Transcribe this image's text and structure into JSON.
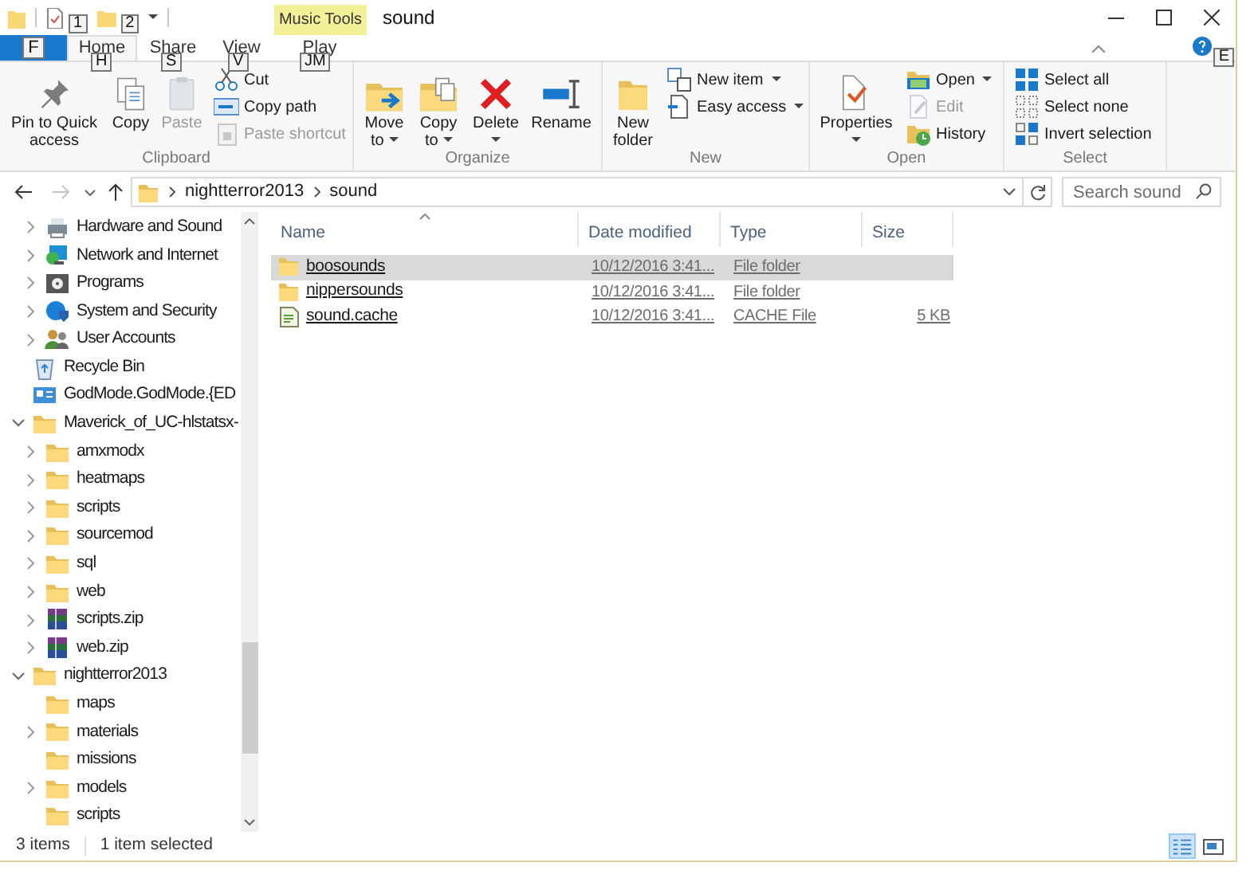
{
  "window": {
    "title": "sound",
    "contextual_group": "Music Tools"
  },
  "quick_access": {
    "keytips": [
      "1",
      "2"
    ]
  },
  "tabs": [
    {
      "kind": "file",
      "keytip": "F",
      "selected": false
    },
    {
      "kind": "tab",
      "label": "Home",
      "keytip": "H",
      "selected": true
    },
    {
      "kind": "tab",
      "label": "Share",
      "keytip": "S",
      "selected": false
    },
    {
      "kind": "tab",
      "label": "View",
      "keytip": "V",
      "selected": false
    },
    {
      "kind": "contextual",
      "label": "Play",
      "keytip": "JM",
      "selected": false
    }
  ],
  "help": {
    "keytip": "E"
  },
  "ribbon": {
    "groups": [
      {
        "label": "Clipboard",
        "items": [
          {
            "kind": "large",
            "label": "Pin to Quick access",
            "disabled": false,
            "dropdown": false
          },
          {
            "kind": "large",
            "label": "Copy",
            "disabled": false,
            "dropdown": false
          },
          {
            "kind": "large",
            "label": "Paste",
            "disabled": true,
            "dropdown": false
          },
          {
            "kind": "small",
            "label": "Cut",
            "disabled": false,
            "dropdown": false
          },
          {
            "kind": "small",
            "label": "Copy path",
            "disabled": false,
            "dropdown": false
          },
          {
            "kind": "small",
            "label": "Paste shortcut",
            "disabled": true,
            "dropdown": false
          }
        ]
      },
      {
        "label": "Organize",
        "items": [
          {
            "kind": "large",
            "label": "Move to",
            "disabled": false,
            "dropdown": true
          },
          {
            "kind": "large",
            "label": "Copy to",
            "disabled": false,
            "dropdown": true
          },
          {
            "kind": "large",
            "label": "Delete",
            "disabled": false,
            "dropdown": true
          },
          {
            "kind": "large",
            "label": "Rename",
            "disabled": false,
            "dropdown": false
          }
        ]
      },
      {
        "label": "New",
        "items": [
          {
            "kind": "large",
            "label": "New folder",
            "disabled": false,
            "dropdown": false
          },
          {
            "kind": "small",
            "label": "New item",
            "disabled": false,
            "dropdown": true
          },
          {
            "kind": "small",
            "label": "Easy access",
            "disabled": false,
            "dropdown": true
          }
        ]
      },
      {
        "label": "Open",
        "items": [
          {
            "kind": "large",
            "label": "Properties",
            "disabled": false,
            "dropdown": true
          },
          {
            "kind": "small",
            "label": "Open",
            "disabled": false,
            "dropdown": true
          },
          {
            "kind": "small",
            "label": "Edit",
            "disabled": true,
            "dropdown": false
          },
          {
            "kind": "small",
            "label": "History",
            "disabled": false,
            "dropdown": false
          }
        ]
      },
      {
        "label": "Select",
        "items": [
          {
            "kind": "small",
            "label": "Select all",
            "disabled": false,
            "dropdown": false
          },
          {
            "kind": "small",
            "label": "Select none",
            "disabled": false,
            "dropdown": false
          },
          {
            "kind": "small",
            "label": "Invert selection",
            "disabled": false,
            "dropdown": false
          }
        ]
      }
    ]
  },
  "navigation": {
    "back_enabled": true,
    "forward_enabled": false
  },
  "address_bar": {
    "crumbs": [
      "nightterror2013",
      "sound"
    ]
  },
  "search": {
    "placeholder": "Search sound"
  },
  "nav_tree": [
    {
      "children": [
        {
          "kind": "hardware",
          "label": "Hardware and Sound",
          "expanded": false
        },
        {
          "kind": "network",
          "label": "Network and Internet",
          "expanded": false
        },
        {
          "kind": "programs",
          "label": "Programs",
          "expanded": false
        },
        {
          "kind": "security",
          "label": "System and Security",
          "expanded": false
        },
        {
          "kind": "users",
          "label": "User Accounts",
          "expanded": false
        }
      ]
    },
    {
      "kind": "recycle",
      "label": "Recycle Bin"
    },
    {
      "kind": "godmode",
      "label": "GodMode.GodMode.{ED"
    },
    {
      "kind": "folder",
      "label": "Maverick_of_UC-hlstatsx-",
      "expanded": true,
      "children": [
        {
          "kind": "folder",
          "label": "amxmodx",
          "expanded": false
        },
        {
          "kind": "folder",
          "label": "heatmaps",
          "expanded": false
        },
        {
          "kind": "folder",
          "label": "scripts",
          "expanded": false
        },
        {
          "kind": "folder",
          "label": "sourcemod",
          "expanded": false
        },
        {
          "kind": "folder",
          "label": "sql",
          "expanded": false
        },
        {
          "kind": "folder",
          "label": "web",
          "expanded": false
        },
        {
          "kind": "zip",
          "label": "scripts.zip",
          "expanded": false
        },
        {
          "kind": "zip",
          "label": "web.zip",
          "expanded": false
        }
      ]
    },
    {
      "kind": "folder",
      "label": "nightterror2013",
      "expanded": true,
      "children": [
        {
          "kind": "folder",
          "label": "maps"
        },
        {
          "kind": "folder",
          "label": "materials",
          "expanded": false
        },
        {
          "kind": "folder",
          "label": "missions"
        },
        {
          "kind": "folder",
          "label": "models",
          "expanded": false
        },
        {
          "kind": "folder",
          "label": "scripts"
        }
      ]
    }
  ],
  "file_list": {
    "columns": [
      {
        "label": "Name",
        "sorted": true
      },
      {
        "label": "Date modified",
        "sorted": false
      },
      {
        "label": "Type",
        "sorted": false
      },
      {
        "label": "Size",
        "sorted": false
      }
    ],
    "rows": [
      {
        "kind": "folder",
        "name": "boosounds",
        "date_modified": "10/12/2016 3:41...",
        "type": "File folder",
        "selected": true
      },
      {
        "kind": "folder",
        "name": "nippersounds",
        "date_modified": "10/12/2016 3:41...",
        "type": "File folder",
        "selected": false
      },
      {
        "kind": "file",
        "name": "sound.cache",
        "date_modified": "10/12/2016 3:41...",
        "type": "CACHE File",
        "size": "5 KB",
        "selected": false
      }
    ]
  },
  "status_bar": {
    "item_count": "3 items",
    "selection": "1 item selected",
    "views": [
      {
        "kind": "details",
        "selected": true
      },
      {
        "kind": "large-icons",
        "selected": false
      }
    ]
  }
}
